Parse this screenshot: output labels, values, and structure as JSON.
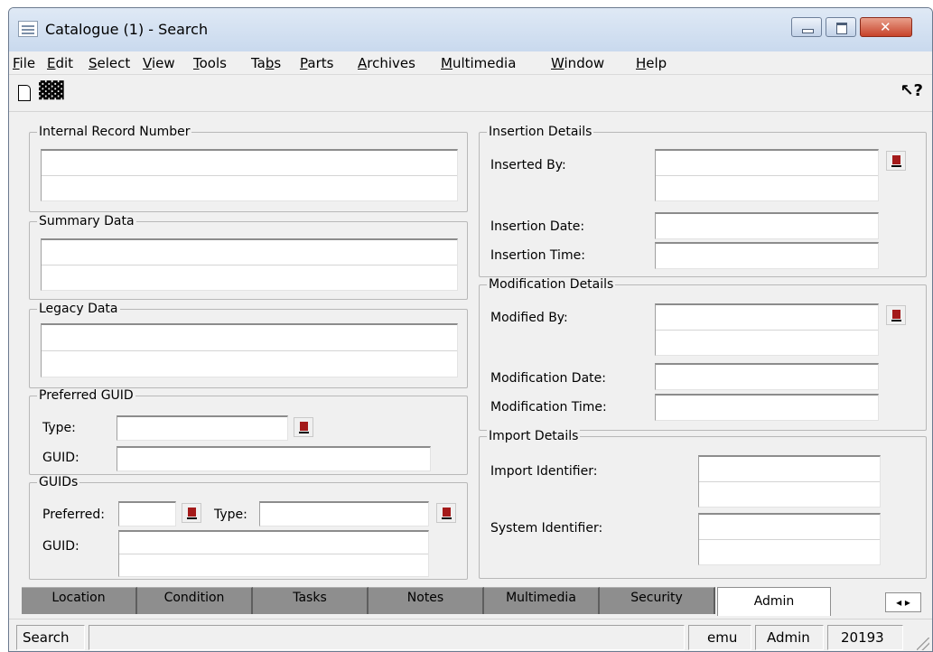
{
  "window": {
    "title": "Catalogue (1) - Search"
  },
  "menu": {
    "items": [
      {
        "pre": "",
        "ul": "F",
        "post": "ile"
      },
      {
        "pre": "",
        "ul": "E",
        "post": "dit"
      },
      {
        "pre": "",
        "ul": "S",
        "post": "elect"
      },
      {
        "pre": "",
        "ul": "V",
        "post": "iew"
      },
      {
        "pre": "",
        "ul": "T",
        "post": "ools"
      },
      {
        "pre": "Ta",
        "ul": "b",
        "post": "s"
      },
      {
        "pre": "",
        "ul": "P",
        "post": "arts"
      },
      {
        "pre": "",
        "ul": "A",
        "post": "rchives"
      },
      {
        "pre": "",
        "ul": "M",
        "post": "ultimedia"
      },
      {
        "pre": "",
        "ul": "W",
        "post": "indow"
      },
      {
        "pre": "",
        "ul": "H",
        "post": "elp"
      }
    ]
  },
  "toolbar": {
    "icons": [
      "new-document-icon",
      "binoculars-search-icon",
      "context-help-icon"
    ],
    "find_glyph": "▓▓",
    "help_glyph": "↖?"
  },
  "left": {
    "irn": {
      "legend": "Internal Record Number"
    },
    "summary": {
      "legend": "Summary Data"
    },
    "legacy": {
      "legend": "Legacy Data"
    },
    "preferred_guid": {
      "legend": "Preferred GUID",
      "type_label": "Type:",
      "guid_label": "GUID:"
    },
    "guids": {
      "legend": "GUIDs",
      "preferred_label": "Preferred:",
      "type_label": "Type:",
      "guid_label": "GUID:"
    }
  },
  "right": {
    "insertion": {
      "legend": "Insertion Details",
      "by_label": "Inserted By:",
      "date_label": "Insertion Date:",
      "time_label": "Insertion Time:"
    },
    "modification": {
      "legend": "Modification Details",
      "by_label": "Modified By:",
      "date_label": "Modification Date:",
      "time_label": "Modification Time:"
    },
    "import": {
      "legend": "Import Details",
      "import_label": "Import Identifier:",
      "system_label": "System Identifier:"
    }
  },
  "tabs": [
    "Location",
    "Condition",
    "Tasks",
    "Notes",
    "Multimedia",
    "Security",
    "Admin"
  ],
  "active_tab": "Admin",
  "tab_scroll": "◂ ▸",
  "status": {
    "mode": "Search",
    "user": "emu",
    "group": "Admin",
    "number": "20193"
  }
}
